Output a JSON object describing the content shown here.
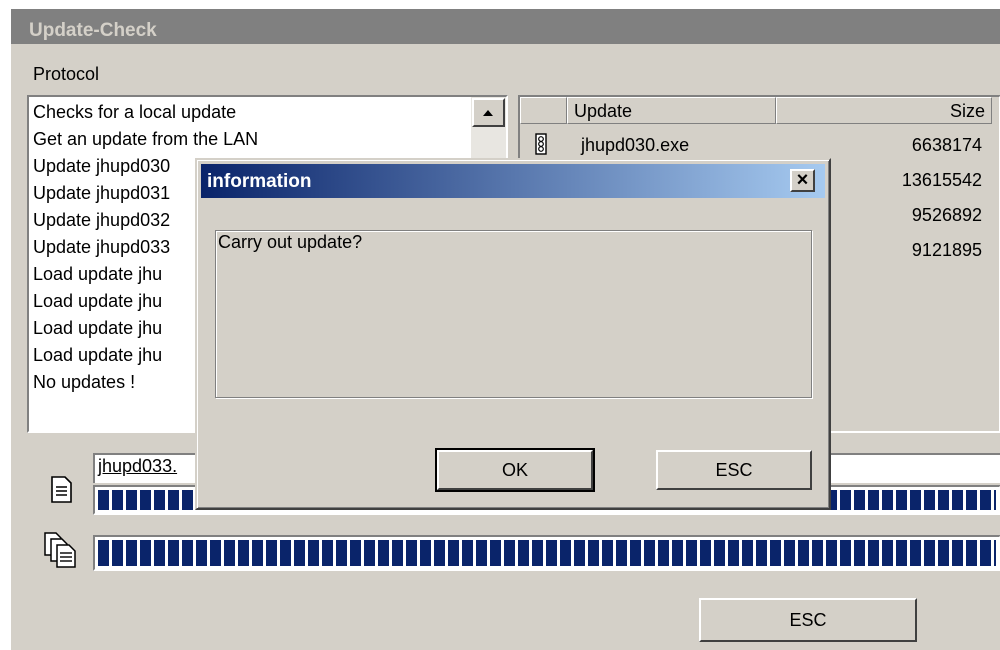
{
  "window": {
    "title": "Update-Check",
    "protocol_label": "Protocol"
  },
  "protocol_list": {
    "items": [
      "Checks for a local update",
      "Get an update from the LAN",
      "Update jhupd030",
      "Update jhupd031",
      "Update jhupd032",
      "Update jhupd033",
      "Load update jhu",
      "Load update jhu",
      "Load update jhu",
      "Load update jhu",
      "No updates !"
    ]
  },
  "updates_table": {
    "columns": [
      "",
      "Update",
      "Size"
    ],
    "rows": [
      {
        "icon": "traffic-light-icon",
        "name": "jhupd030.exe",
        "size": "6638174"
      },
      {
        "icon": "",
        "name": "",
        "size": "13615542"
      },
      {
        "icon": "",
        "name": "",
        "size": "9526892"
      },
      {
        "icon": "",
        "name": "",
        "size": "9121895"
      }
    ]
  },
  "current_file": {
    "value": "jhupd033."
  },
  "progress": {
    "file_percent": 100,
    "total_percent": 100
  },
  "buttons": {
    "esc_main": "ESC"
  },
  "dialog": {
    "title": "information",
    "close_label": "×",
    "message": "Carry out update?",
    "ok_label": "OK",
    "esc_label": "ESC"
  },
  "colors": {
    "progress_fill": "#0a246a",
    "dialog_title_start": "#0a246a",
    "dialog_title_end": "#a6caf0"
  }
}
